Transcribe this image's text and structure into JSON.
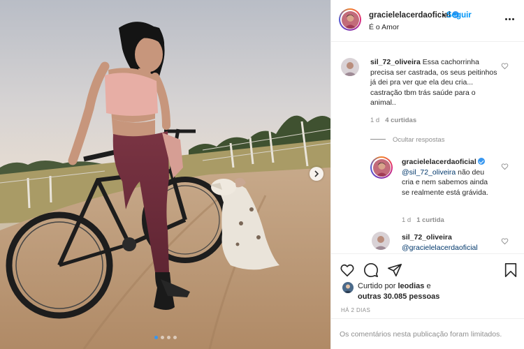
{
  "header": {
    "username": "gracielelacerdaoficial",
    "follow_label": "Seguir",
    "subtitle": "É o Amor",
    "dot": "•"
  },
  "comments": [
    {
      "username": "sil_72_oliveira",
      "text": "Essa cachorrinha precisa ser castrada, os seus peitinhos já dei pra ver que ela deu cria... castração tbm trás saúde para o animal..",
      "time": "1 d",
      "likes": "4 curtidas",
      "hide_replies": "Ocultar respostas"
    },
    {
      "username": "gracielelacerdaoficial",
      "mention": "@sil_72_oliveira",
      "text": "não deu cria e nem sabemos ainda se realmente está grávida.",
      "time": "1 d",
      "likes": "1 curtida"
    },
    {
      "username": "sil_72_oliveira",
      "mention": "@gracielelacerdaoficial"
    }
  ],
  "actions": {
    "liked_by_prefix": "Curtido por",
    "liked_by_user": "leodias",
    "liked_by_and": "e",
    "liked_by_others": "outras 30.085 pessoas",
    "time_ago": "HÁ 2 DIAS",
    "comments_limited": "Os comentários nesta publicação foram limitados."
  },
  "carousel": {
    "slide_count": 4,
    "active_slide": 1
  },
  "colors": {
    "accent": "#0095f6",
    "text": "#262626",
    "muted": "#8e8e8e",
    "border": "#efefef"
  },
  "icons": [
    "heart-icon",
    "comment-icon",
    "share-icon",
    "bookmark-icon",
    "more-icon",
    "verified-icon",
    "chevron-right-icon"
  ]
}
